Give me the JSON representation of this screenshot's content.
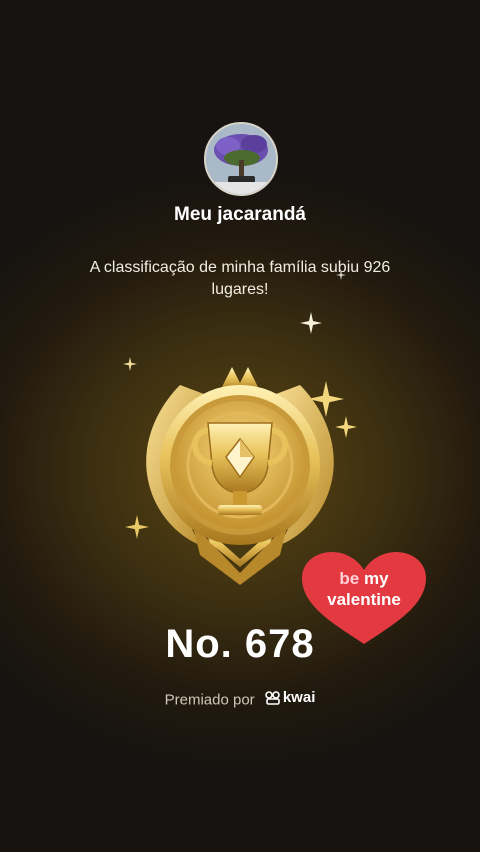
{
  "profile": {
    "name": "Meu jacarandá",
    "avatar_icon": "jacaranda-tree-photo"
  },
  "message": "A classificação de minha família subiu 926 lugares!",
  "badge": {
    "icon": "gold-trophy-medal",
    "rank": "No. 678"
  },
  "awarded": {
    "prefix": "Premiado por",
    "brand": "kwai"
  },
  "sticker": {
    "word1": "be",
    "word2": "my",
    "word3": "valentine",
    "color": "#e23a40"
  },
  "colors": {
    "background": "#3c2f11",
    "gold": "#e8c25a"
  }
}
